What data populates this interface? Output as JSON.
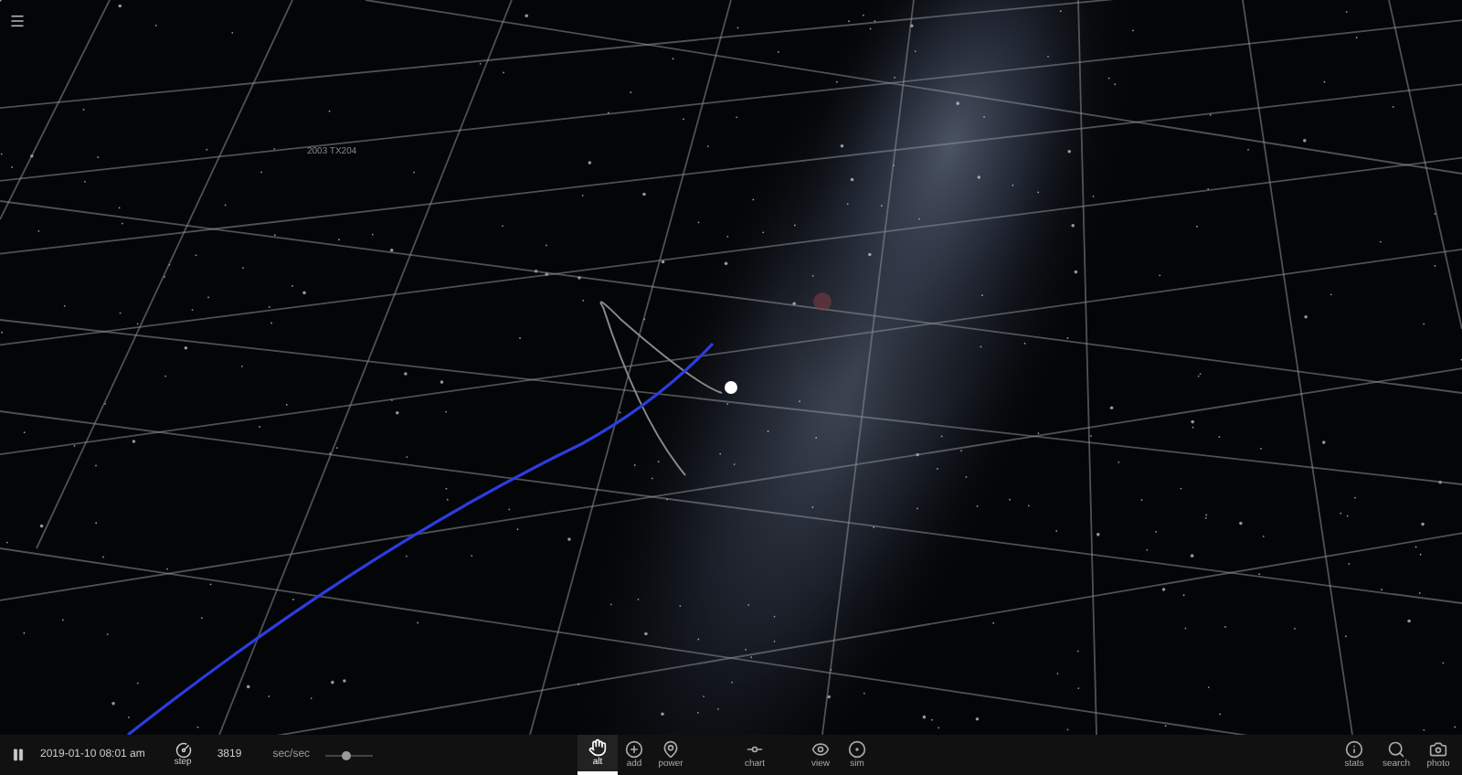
{
  "scene": {
    "object_label": "2003 TX204"
  },
  "time_controls": {
    "playing": true,
    "date": "2019-01-10 08:01 am",
    "step_label": "step",
    "rate": "3819",
    "rate_unit": "sec/sec",
    "speed": {
      "level": 0.45
    }
  },
  "tools": [
    {
      "kind": "hand",
      "label": "alt",
      "selected": true
    },
    {
      "kind": "add",
      "label": "add",
      "selected": false
    },
    {
      "kind": "pin",
      "label": "power",
      "selected": false
    },
    {
      "kind": "chart",
      "label": "chart",
      "selected": false
    },
    {
      "kind": "eye",
      "label": "view",
      "selected": false
    },
    {
      "kind": "target",
      "label": "sim",
      "selected": false
    }
  ],
  "right_tools": [
    {
      "kind": "info",
      "label": "stats"
    },
    {
      "kind": "search",
      "label": "search"
    },
    {
      "kind": "camera",
      "label": "photo"
    }
  ]
}
